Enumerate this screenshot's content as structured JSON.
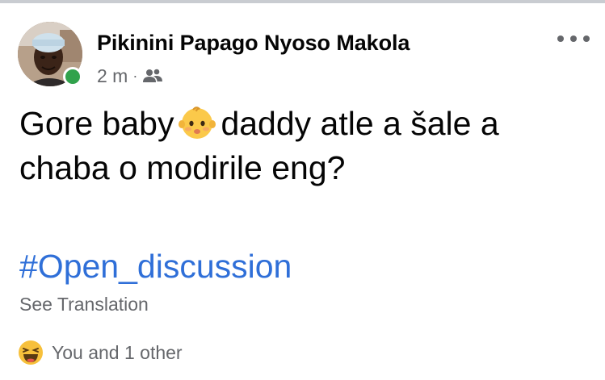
{
  "post": {
    "author": {
      "name": "Pikinini Papago Nyoso Makola",
      "avatar_icon": "profile-photo",
      "online": true,
      "online_color": "#31a24c"
    },
    "meta": {
      "time": "2 m",
      "separator": "·",
      "audience_icon": "friends-icon"
    },
    "more_icon": "more-options-icon",
    "text": {
      "line1_before": "Gore baby",
      "emoji": "baby-emoji",
      "line1_after": "daddy atle a šale a",
      "line2": "chaba o modirile eng?"
    },
    "hashtag": "#Open_discussion",
    "see_translation": "See Translation",
    "reactions": {
      "icon": "haha-reaction-icon",
      "summary": "You and 1 other"
    }
  },
  "colors": {
    "text": "#050505",
    "secondary": "#65676b",
    "link": "#2f6fd8",
    "divider": "#c9ccd1"
  }
}
